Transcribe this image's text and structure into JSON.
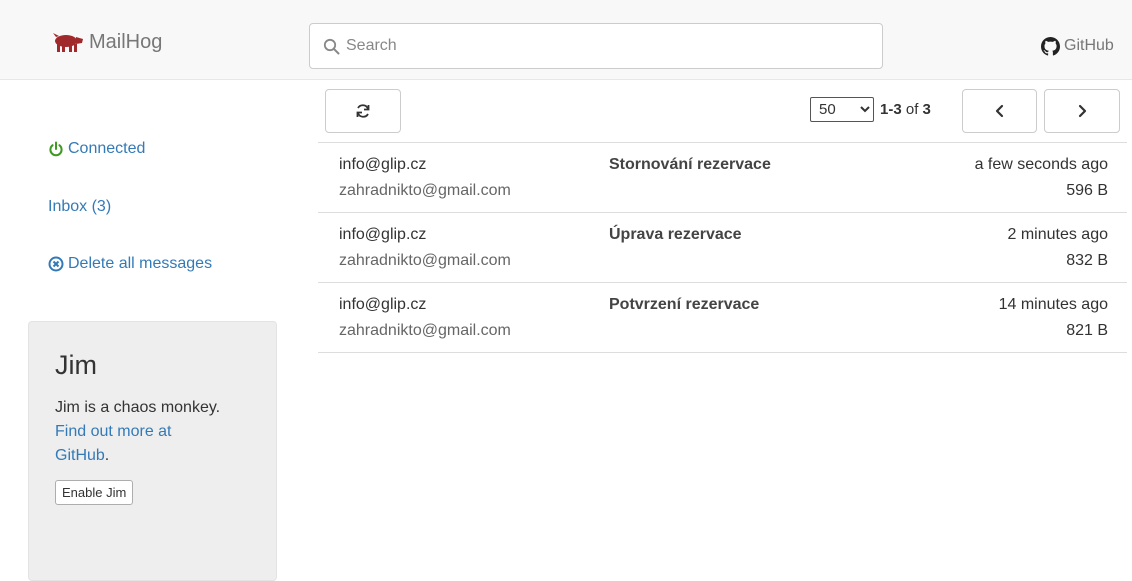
{
  "navbar": {
    "brand": "MailHog",
    "brand_icon": "pig-logo-icon",
    "search_placeholder": "Search",
    "github_label": "GitHub"
  },
  "colors": {
    "link": "#337ab7",
    "connected": "#3c9a1f",
    "logo": "#a0292c",
    "navbar_bg": "#f8f8f8"
  },
  "sidebar": {
    "connected_label": "Connected",
    "inbox_label": "Inbox (3)",
    "delete_label": "Delete all messages"
  },
  "jim": {
    "title": "Jim",
    "description": "Jim is a chaos monkey.",
    "more_link": "Find out more at GitHub",
    "more_suffix": ".",
    "enable_button": "Enable Jim"
  },
  "pagination": {
    "per_page_options": [
      "50"
    ],
    "per_page_selected": "50",
    "range": "1-3",
    "of_label": "of",
    "total": "3"
  },
  "messages": [
    {
      "from": "info@glip.cz",
      "to": "zahradnikto@gmail.com",
      "subject": "Stornování rezervace",
      "time": "a few seconds ago",
      "size": "596 B"
    },
    {
      "from": "info@glip.cz",
      "to": "zahradnikto@gmail.com",
      "subject": "Úprava rezervace",
      "time": "2 minutes ago",
      "size": "832 B"
    },
    {
      "from": "info@glip.cz",
      "to": "zahradnikto@gmail.com",
      "subject": "Potvrzení rezervace",
      "time": "14 minutes ago",
      "size": "821 B"
    }
  ]
}
